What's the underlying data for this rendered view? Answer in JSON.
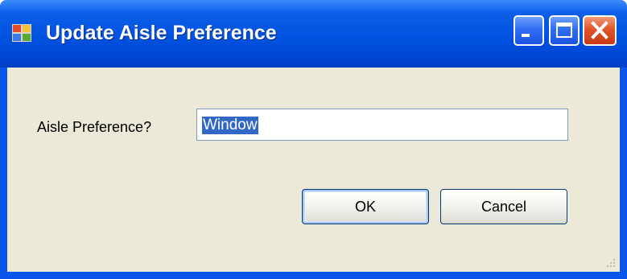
{
  "window": {
    "title": "Update Aisle Preference",
    "icon": "app-form-icon"
  },
  "title_buttons": {
    "minimize": "minimize-icon",
    "maximize": "maximize-icon",
    "close": "close-icon"
  },
  "form": {
    "label": "Aisle Preference?",
    "value": "Window"
  },
  "buttons": {
    "ok": "OK",
    "cancel": "Cancel"
  },
  "colors": {
    "titlebar": "#0052e0",
    "client": "#ece9d8",
    "selection": "#3168c6",
    "close_button": "#e0542c"
  }
}
